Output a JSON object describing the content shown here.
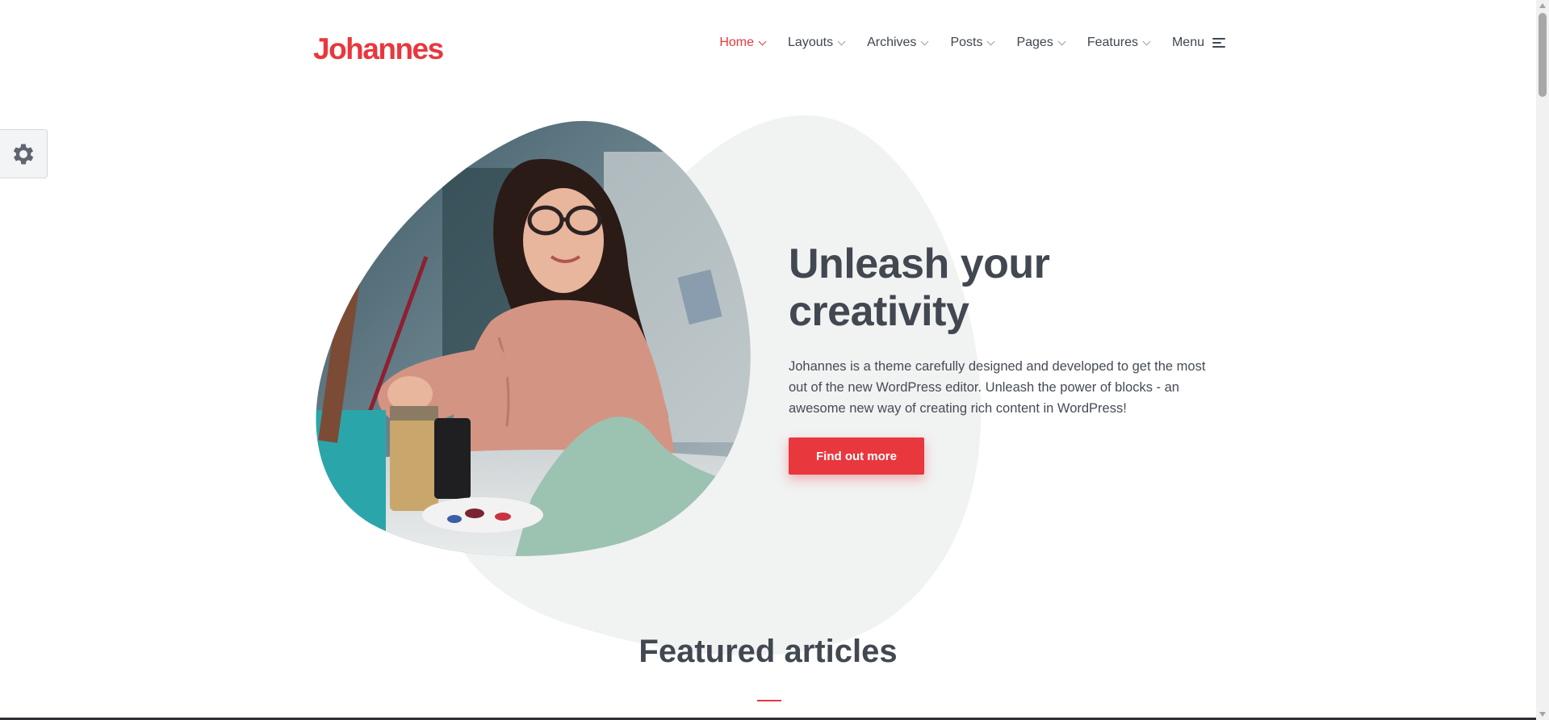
{
  "site": {
    "logo": "Johannes"
  },
  "nav": {
    "items": [
      {
        "label": "Home",
        "active": true
      },
      {
        "label": "Layouts"
      },
      {
        "label": "Archives"
      },
      {
        "label": "Posts"
      },
      {
        "label": "Pages"
      },
      {
        "label": "Features"
      }
    ],
    "menu_label": "Menu"
  },
  "hero": {
    "title_line1": "Unleash your",
    "title_line2": "creativity",
    "description": "Johannes is a theme carefully designed and developed to get the most out of the new WordPress editor. Unleash the power of blocks - an awesome new way of creating rich content in WordPress!",
    "button_label": "Find out more"
  },
  "featured": {
    "title": "Featured articles"
  },
  "colors": {
    "accent": "#e9373e",
    "text": "#424851",
    "blob": "#f1f2f2"
  },
  "icons": {
    "settings": "gear-icon",
    "menu": "hamburger-icon",
    "dropdown": "chevron-down-icon"
  }
}
